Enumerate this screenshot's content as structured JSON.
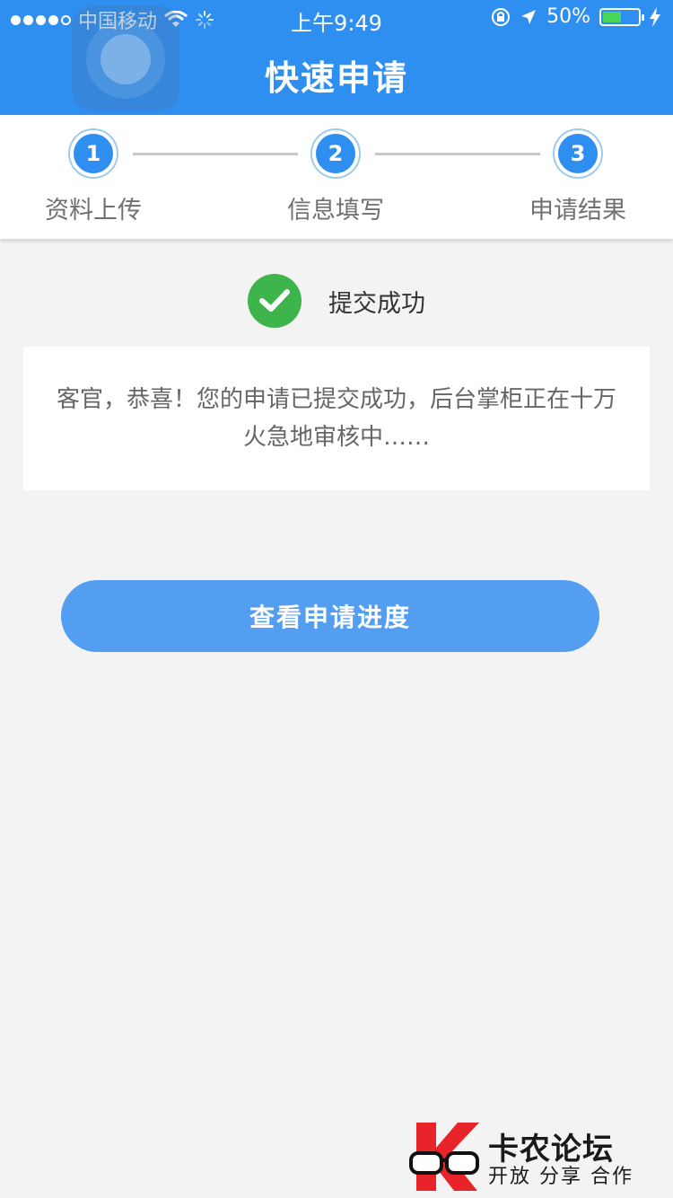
{
  "status_bar": {
    "carrier": "中国移动",
    "time": "上午9:49",
    "battery": "50%"
  },
  "nav": {
    "title": "快速申请"
  },
  "stepper": {
    "steps": [
      {
        "number": "1",
        "label": "资料上传"
      },
      {
        "number": "2",
        "label": "信息填写"
      },
      {
        "number": "3",
        "label": "申请结果"
      }
    ]
  },
  "result": {
    "status": "提交成功",
    "message": "客官，恭喜！您的申请已提交成功，后台掌柜正在十万火急地审核中……"
  },
  "actions": {
    "view_progress": "查看申请进度"
  },
  "watermark": {
    "title": "卡农论坛",
    "subtitle": "开放 分享 合作"
  },
  "colors": {
    "primary": "#2f8ff0",
    "button": "#549ef2",
    "success": "#3db54a",
    "background": "#f3f3f3"
  }
}
